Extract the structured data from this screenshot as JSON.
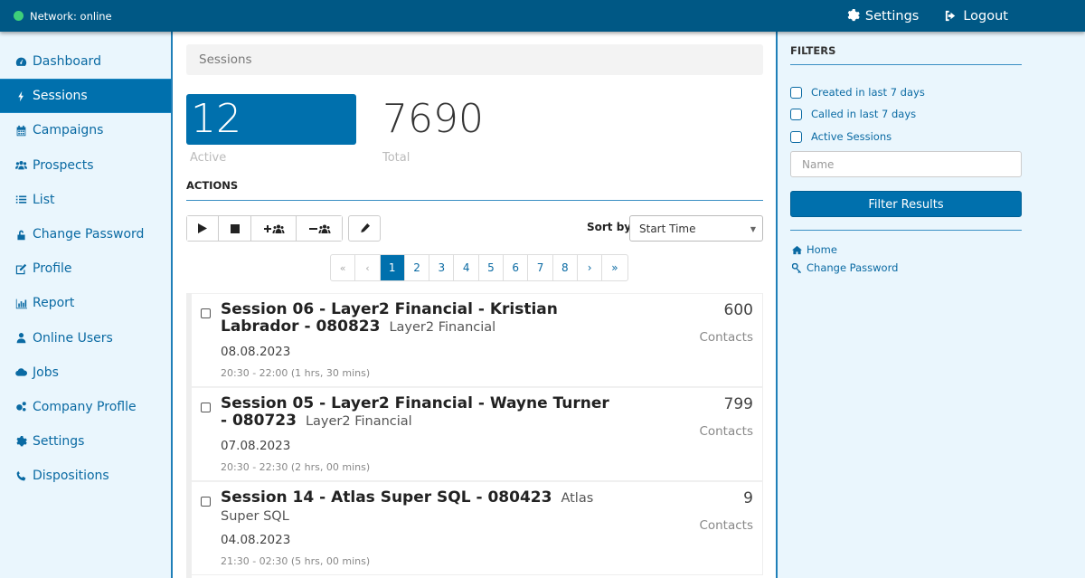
{
  "topbar": {
    "network_status": "Network: online",
    "status_color": "#3ecf7a",
    "settings_label": "Settings",
    "logout_label": "Logout"
  },
  "sidebar": {
    "items": [
      {
        "label": "Dashboard",
        "icon": "tachometer-icon",
        "active": false
      },
      {
        "label": "Sessions",
        "icon": "bolt-icon",
        "active": true
      },
      {
        "label": "Campaigns",
        "icon": "calendar-icon",
        "active": false
      },
      {
        "label": "Prospects",
        "icon": "users-icon",
        "active": false
      },
      {
        "label": "List",
        "icon": "list-icon",
        "active": false
      },
      {
        "label": "Change Password",
        "icon": "unlock-icon",
        "active": false
      },
      {
        "label": "Profile",
        "icon": "edit-icon",
        "active": false
      },
      {
        "label": "Report",
        "icon": "bar-chart-icon",
        "active": false
      },
      {
        "label": "Online Users",
        "icon": "user-icon",
        "active": false
      },
      {
        "label": "Jobs",
        "icon": "cloud-icon",
        "active": false
      },
      {
        "label": "Company Proflle",
        "icon": "cogs-icon",
        "active": false
      },
      {
        "label": "Settings",
        "icon": "gear-icon",
        "active": false
      },
      {
        "label": "Dispositions",
        "icon": "phone-icon",
        "active": false
      }
    ]
  },
  "main": {
    "breadcrumb": "Sessions",
    "stats": {
      "active_value": "12",
      "active_label": "Active",
      "total_value": "7690",
      "total_label": "Total"
    },
    "actions_heading": "ACTIONS",
    "action_buttons": [
      "play",
      "stop",
      "add-users",
      "remove-users",
      "edit"
    ],
    "sort_label": "Sort by:",
    "sort_value": "Start Time",
    "pagination": {
      "first": "«",
      "prev": "‹",
      "pages": [
        "1",
        "2",
        "3",
        "4",
        "5",
        "6",
        "7",
        "8"
      ],
      "current": "1",
      "next": "›",
      "last": "»"
    },
    "sessions": [
      {
        "title": "Session 06 - Layer2 Financial - Kristian Labrador - 080823",
        "company": "Layer2 Financial",
        "date": "08.08.2023",
        "time": "20:30 - 22:00 (1 hrs, 30 mins)",
        "count": "600",
        "count_label": "Contacts"
      },
      {
        "title": "Session 05 - Layer2 Financial - Wayne Turner - 080723",
        "company": "Layer2 Financial",
        "date": "07.08.2023",
        "time": "20:30 - 22:30 (2 hrs, 00 mins)",
        "count": "799",
        "count_label": "Contacts"
      },
      {
        "title": "Session 14 - Atlas Super SQL - 080423",
        "company": "Atlas Super SQL",
        "date": "04.08.2023",
        "time": "21:30 - 02:30 (5 hrs, 00 mins)",
        "count": "9",
        "count_label": "Contacts"
      }
    ]
  },
  "filters": {
    "heading": "FILTERS",
    "checkboxes": [
      {
        "label": "Created in last 7 days",
        "checked": false
      },
      {
        "label": "Called in last 7 days",
        "checked": false
      },
      {
        "label": "Active Sessions",
        "checked": false
      }
    ],
    "name_placeholder": "Name",
    "name_value": "",
    "submit_label": "Filter Results",
    "links": [
      {
        "label": "Home",
        "icon": "home-icon"
      },
      {
        "label": "Change Password",
        "icon": "key-icon"
      }
    ]
  },
  "colors": {
    "primary": "#0070ad",
    "topbar": "#005885",
    "sidebar_bg": "#eaf6fd",
    "link": "#0a6aa3"
  }
}
